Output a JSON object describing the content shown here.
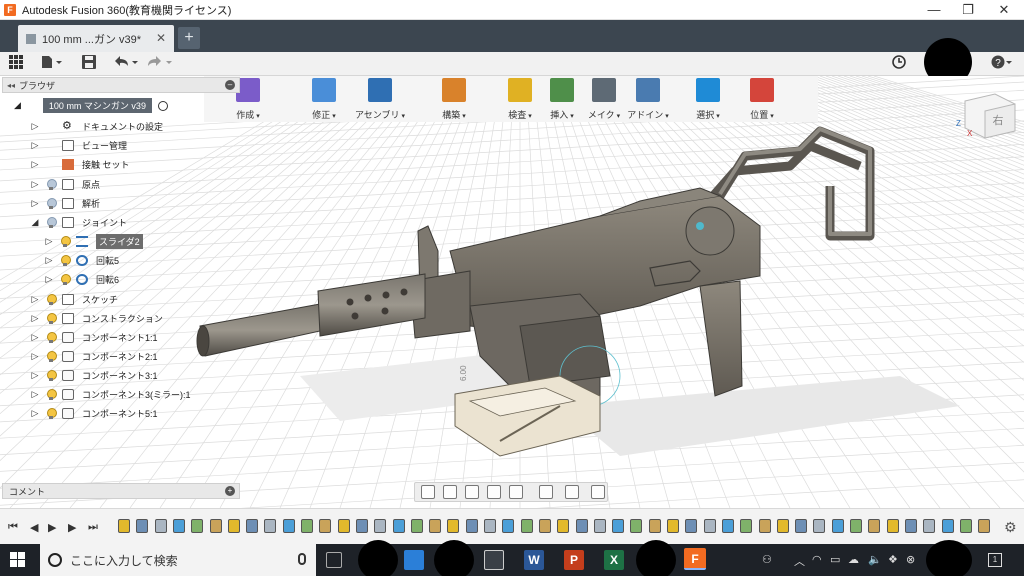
{
  "window": {
    "title": "Autodesk Fusion 360(教育機関ライセンス)",
    "app_logo": "F",
    "min": "—",
    "restore": "❐",
    "close": "✕"
  },
  "tabs": {
    "doc_tab": "100 mm ...ガン v39*",
    "tab_close": "✕",
    "new_tab": "+"
  },
  "toolbar": {
    "tools": [
      {
        "label": "作成",
        "color": "#7b5cc9"
      },
      {
        "label": "修正",
        "color": "#4a8ed8"
      },
      {
        "label": "アセンブリ",
        "color": "#2f6fb3"
      },
      {
        "label": "構築",
        "color": "#d9822b"
      },
      {
        "label": "検査",
        "color": "#e0b123"
      },
      {
        "label": "挿入",
        "color": "#4f8f4a"
      },
      {
        "label": "メイク",
        "color": "#5e6a75"
      },
      {
        "label": "アドイン",
        "color": "#4a7bb0"
      },
      {
        "label": "選択",
        "color": "#1f8bd6"
      },
      {
        "label": "位置",
        "color": "#d4453b"
      }
    ]
  },
  "browser": {
    "title": "ブラウザ",
    "root": "100 mm マシンガン v39",
    "items": [
      {
        "label": "ドキュメントの設定",
        "icon": "gear-icon",
        "bulb": "none"
      },
      {
        "label": "ビュー管理",
        "icon": "folder-icon",
        "bulb": "none"
      },
      {
        "label": "接触 セット",
        "icon": "contact-icon",
        "bulb": "none"
      },
      {
        "label": "原点",
        "icon": "folder-icon",
        "bulb": "off"
      },
      {
        "label": "解析",
        "icon": "folder-icon",
        "bulb": "off"
      },
      {
        "label": "ジョイント",
        "icon": "folder-icon",
        "bulb": "off"
      },
      {
        "label": "スライダ2",
        "icon": "slider-joint-icon",
        "bulb": "on",
        "selected": true
      },
      {
        "label": "回転5",
        "icon": "revolute-joint-icon",
        "bulb": "on"
      },
      {
        "label": "回転6",
        "icon": "revolute-joint-icon",
        "bulb": "on"
      },
      {
        "label": "スケッチ",
        "icon": "folder-icon",
        "bulb": "on"
      },
      {
        "label": "コンストラクション",
        "icon": "folder-icon",
        "bulb": "on"
      },
      {
        "label": "コンポーネント1:1",
        "icon": "component-icon",
        "bulb": "on"
      },
      {
        "label": "コンポーネント2:1",
        "icon": "component-icon",
        "bulb": "on"
      },
      {
        "label": "コンポーネント3:1",
        "icon": "component-icon",
        "bulb": "on"
      },
      {
        "label": "コンポーネント3(ミラー):1",
        "icon": "component-icon",
        "bulb": "on"
      },
      {
        "label": "コンポーネント5:1",
        "icon": "component-icon",
        "bulb": "on"
      }
    ]
  },
  "comments": {
    "title": "コメント"
  },
  "viewcube": {
    "face": "右",
    "z_axis": "Z",
    "x_axis": "X"
  },
  "dimension_label": "6.00",
  "taskbar": {
    "search_placeholder": "ここに入力して検索",
    "word": "W",
    "powerpoint": "P",
    "excel": "X",
    "fusion": "F",
    "notification_count": "1"
  }
}
